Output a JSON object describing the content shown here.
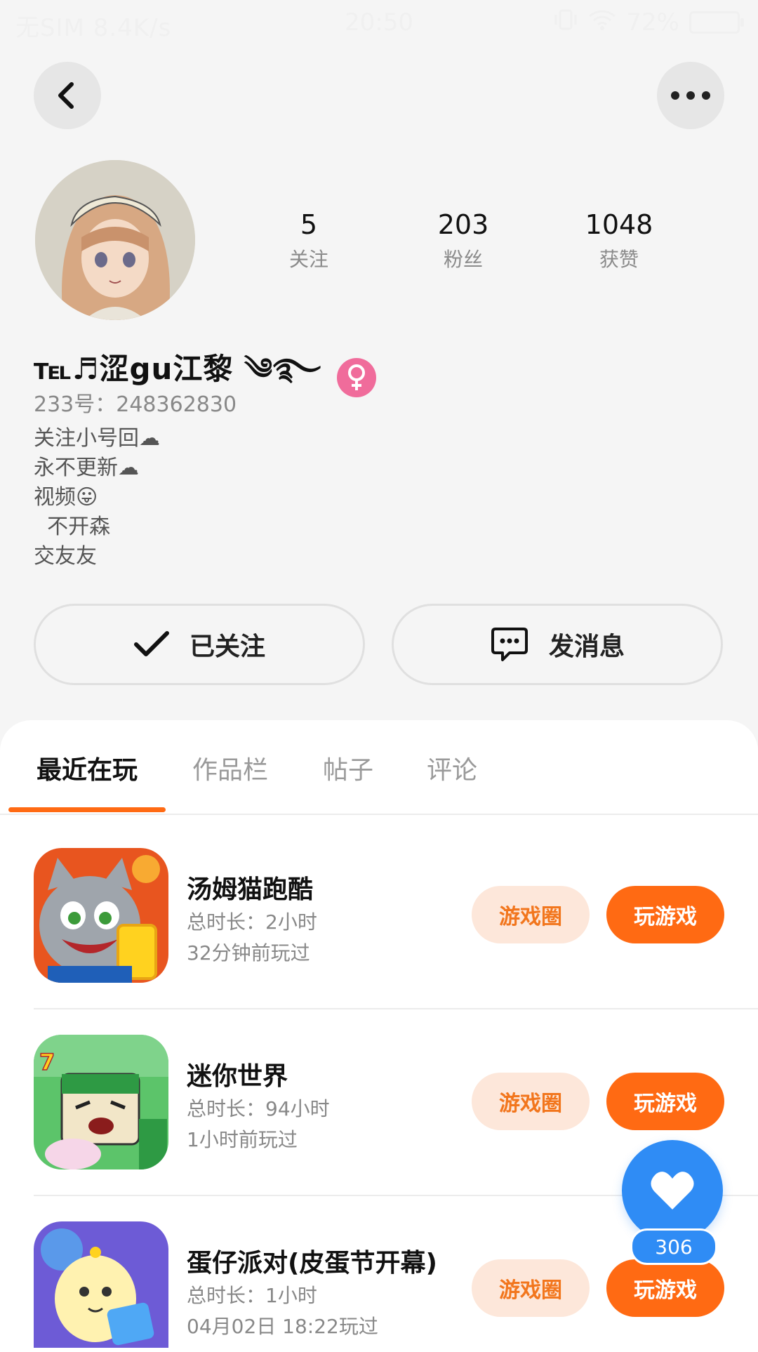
{
  "status_bar": {
    "carrier": "无SIM 8.4K/s",
    "time": "20:50",
    "battery": "72%"
  },
  "profile": {
    "stats": [
      {
        "num": "5",
        "label": "关注"
      },
      {
        "num": "203",
        "label": "粉丝"
      },
      {
        "num": "1048",
        "label": "获赞"
      }
    ],
    "nickname": "℡♬涩gu江黎 ༄࿐",
    "uid": "233号：248362830",
    "bio": [
      "关注小号回☁",
      "永不更新☁",
      "视频😛",
      "  不开森",
      "交友友"
    ]
  },
  "actions": {
    "followed_label": "已关注",
    "message_label": "发消息"
  },
  "tabs": [
    "最近在玩",
    "作品栏",
    "帖子",
    "评论"
  ],
  "games": [
    {
      "title": "汤姆猫跑酷",
      "duration": "总时长：2小时",
      "last_played": "32分钟前玩过",
      "circle_label": "游戏圈",
      "play_label": "玩游戏",
      "icon": "talking-tom-icon"
    },
    {
      "title": "迷你世界",
      "duration": "总时长：94小时",
      "last_played": "1小时前玩过",
      "circle_label": "游戏圈",
      "play_label": "玩游戏",
      "icon": "mini-world-icon"
    },
    {
      "title": "蛋仔派对(皮蛋节开幕)",
      "duration": "总时长：1小时",
      "last_played": "04月02日 18:22玩过",
      "circle_label": "游戏圈",
      "play_label": "玩游戏",
      "icon": "eggy-party-icon"
    }
  ],
  "fav": {
    "count": "306"
  },
  "colors": {
    "accent": "#ff6a13",
    "fav_blue": "#2f8cf5",
    "gender_pink": "#f06c9b"
  }
}
